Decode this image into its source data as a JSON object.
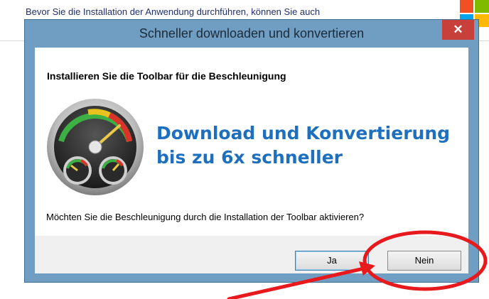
{
  "background": {
    "text": "Bevor Sie die Installation der Anwendung durchführen, können Sie auch"
  },
  "dialog": {
    "title": "Schneller downloaden und konvertieren",
    "close_label": "✕",
    "heading": "Installieren Sie die Toolbar für die Beschleunigung",
    "promo_line1": "Download und Konvertierung",
    "promo_line2": "bis zu 6x schneller",
    "question": "Möchten Sie die Beschleunigung durch die Installation der Toolbar aktivieren?",
    "buttons": {
      "yes_label": "Ja",
      "no_label": "Nein"
    },
    "icon": "speedometer-icon"
  },
  "annotation": {
    "color": "#e8191c",
    "target": "Nein"
  }
}
